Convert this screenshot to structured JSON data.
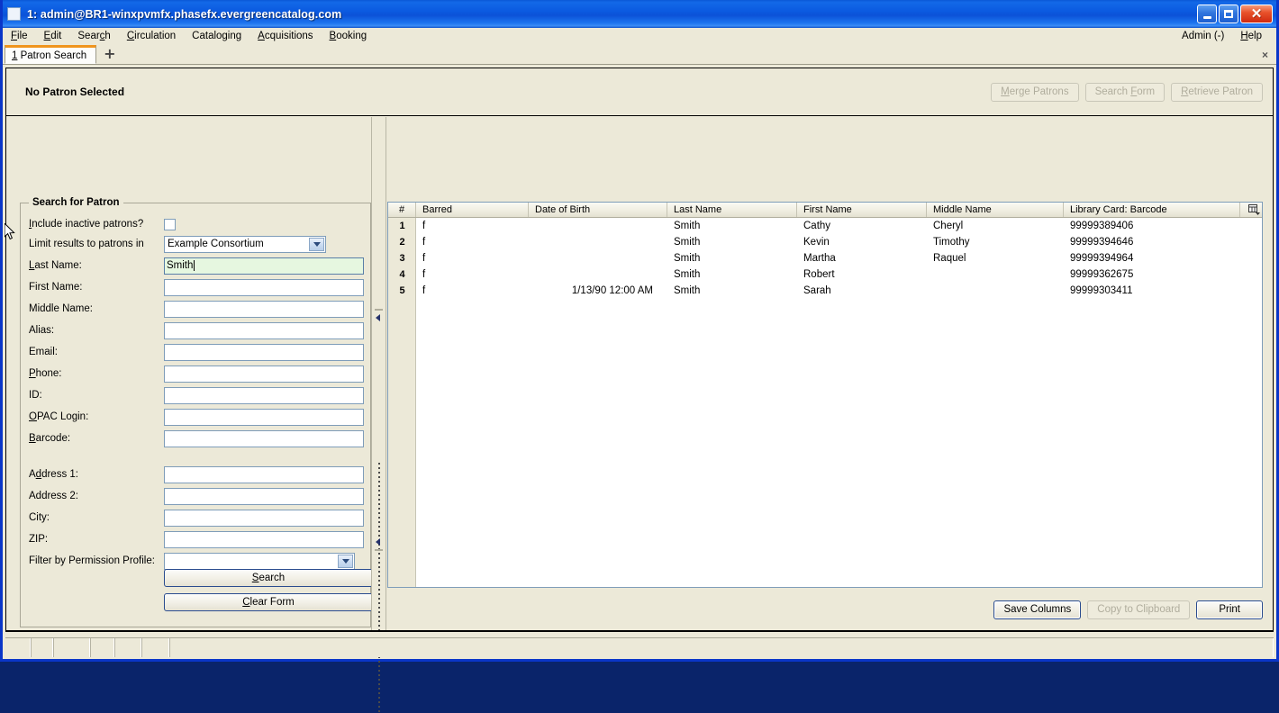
{
  "window": {
    "title": "1: admin@BR1-winxpvmfx.phasefx.evergreencatalog.com",
    "minimize_label": "Minimize",
    "maximize_label": "Maximize",
    "close_label": "Close"
  },
  "menubar": {
    "items": [
      {
        "label": "File",
        "accel": "F"
      },
      {
        "label": "Edit",
        "accel": "E"
      },
      {
        "label": "Search",
        "accel": "c"
      },
      {
        "label": "Circulation",
        "accel": "C"
      },
      {
        "label": "Cataloging",
        "accel": "g"
      },
      {
        "label": "Acquisitions",
        "accel": "A"
      },
      {
        "label": "Booking",
        "accel": "B"
      }
    ],
    "right": [
      {
        "label": "Admin (-)",
        "accel": ""
      },
      {
        "label": "Help",
        "accel": "H"
      }
    ]
  },
  "tabs": {
    "active": "1 Patron Search",
    "add_label": "+",
    "close_label": "×"
  },
  "patron_header": {
    "title": "No Patron Selected",
    "buttons": [
      {
        "label": "Merge Patrons",
        "disabled": true
      },
      {
        "label": "Search Form",
        "disabled": true
      },
      {
        "label": "Retrieve Patron",
        "disabled": true
      }
    ]
  },
  "search_form": {
    "legend": "Search for Patron",
    "include_inactive_label": "Include inactive patrons?",
    "include_inactive_checked": false,
    "limit_label": "Limit results to patrons in",
    "limit_value": "Example Consortium",
    "fields": [
      {
        "label": "Last Name:",
        "value": "Smith",
        "active": true
      },
      {
        "label": "First Name:",
        "value": "",
        "active": false
      },
      {
        "label": "Middle Name:",
        "value": "",
        "active": false
      },
      {
        "label": "Alias:",
        "value": "",
        "active": false
      },
      {
        "label": "Email:",
        "value": "",
        "active": false
      },
      {
        "label": "Phone:",
        "value": "",
        "active": false
      },
      {
        "label": "ID:",
        "value": "",
        "active": false
      },
      {
        "label": "OPAC Login:",
        "value": "",
        "active": false
      },
      {
        "label": "Barcode:",
        "value": "",
        "active": false
      },
      {
        "label": "Address 1:",
        "value": "",
        "active": false
      },
      {
        "label": "Address 2:",
        "value": "",
        "active": false
      },
      {
        "label": "City:",
        "value": "",
        "active": false
      },
      {
        "label": "ZIP:",
        "value": "",
        "active": false
      }
    ],
    "profile_label": "Filter by Permission Profile:",
    "profile_value": "",
    "search_button": "Search",
    "clear_button": "Clear Form"
  },
  "results": {
    "columns": [
      "#",
      "Barred",
      "Date of Birth",
      "Last Name",
      "First Name",
      "Middle Name",
      "Library Card: Barcode"
    ],
    "column_picker_icon": "column-picker-icon",
    "rows": [
      {
        "num": "1",
        "barred": "f",
        "dob": "",
        "last": "Smith",
        "first": "Cathy",
        "middle": "Cheryl",
        "barcode": "99999389406"
      },
      {
        "num": "2",
        "barred": "f",
        "dob": "",
        "last": "Smith",
        "first": "Kevin",
        "middle": "Timothy",
        "barcode": "99999394646"
      },
      {
        "num": "3",
        "barred": "f",
        "dob": "",
        "last": "Smith",
        "first": "Martha",
        "middle": "Raquel",
        "barcode": "99999394964"
      },
      {
        "num": "4",
        "barred": "f",
        "dob": "",
        "last": "Smith",
        "first": "Robert",
        "middle": "",
        "barcode": "99999362675"
      },
      {
        "num": "5",
        "barred": "f",
        "dob": "1/13/90 12:00 AM",
        "last": "Smith",
        "first": "Sarah",
        "middle": "",
        "barcode": "99999303411"
      }
    ],
    "actions": [
      {
        "label": "Save Columns",
        "disabled": false
      },
      {
        "label": "Copy to Clipboard",
        "disabled": true
      },
      {
        "label": "Print",
        "disabled": false
      }
    ]
  },
  "statusbar": {
    "cells": [
      "",
      "",
      "",
      "",
      "",
      "",
      ""
    ]
  },
  "colors": {
    "title_blue": "#0b52d8",
    "window_bg": "#ece9d8",
    "active_field": "#e6f7e0",
    "tab_accent": "#f0951e",
    "field_border": "#7f9db9"
  }
}
